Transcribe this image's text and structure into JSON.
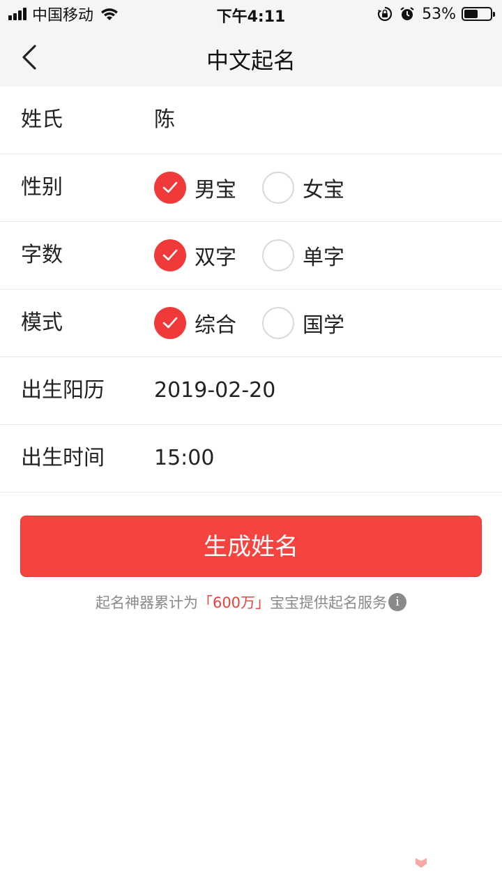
{
  "status_bar": {
    "carrier": "中国移动",
    "time": "下午4:11",
    "battery_percent": "53%",
    "battery_level": 0.53,
    "icons": [
      "signal-icon",
      "wifi-icon",
      "rotation-lock-icon",
      "alarm-icon",
      "battery-icon"
    ]
  },
  "nav": {
    "title": "中文起名",
    "back_icon": "chevron-left-icon"
  },
  "form": {
    "surname": {
      "label": "姓氏",
      "value": "陈"
    },
    "gender": {
      "label": "性别",
      "options": [
        "男宝",
        "女宝"
      ],
      "selected": "男宝"
    },
    "char_count": {
      "label": "字数",
      "options": [
        "双字",
        "单字"
      ],
      "selected": "双字"
    },
    "mode": {
      "label": "模式",
      "options": [
        "综合",
        "国学"
      ],
      "selected": "综合"
    },
    "birth_date": {
      "label": "出生阳历",
      "value": "2019-02-20"
    },
    "birth_time": {
      "label": "出生时间",
      "value": "15:00"
    }
  },
  "generate_button": {
    "label": "生成姓名"
  },
  "footnote": {
    "prefix": "起名神器累计为",
    "highlight": "「600万」",
    "suffix": "宝宝提供起名服务",
    "info_icon": "i"
  },
  "colors": {
    "accent": "#f5433f",
    "checked": "#f03a3a",
    "highlight": "#e8423d",
    "muted": "#8a8a8a",
    "divider": "#e6e6e6",
    "header_bg": "#f5f5f5"
  }
}
